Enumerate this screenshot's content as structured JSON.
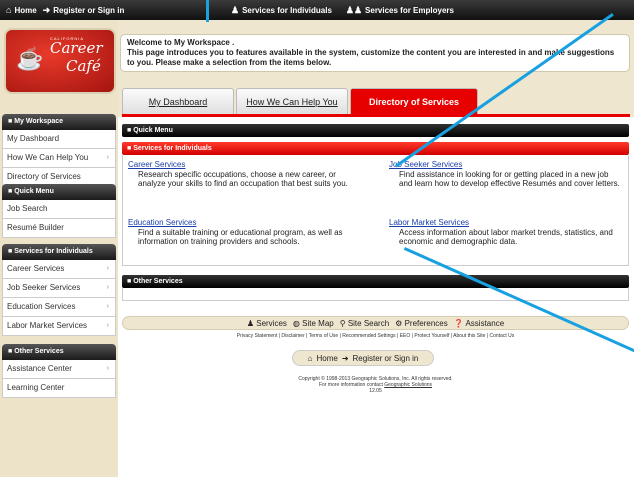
{
  "topbar": {
    "home": "Home",
    "register": "Register or Sign in",
    "individuals": "Services for Individuals",
    "employers": "Services for Employers"
  },
  "logo": {
    "small": "CALIFORNIA",
    "line1": "Career",
    "line2": "Café"
  },
  "welcome": {
    "title": "Welcome to My Workspace .",
    "text": "This page introduces you to features available in the system, customize the content you are interested in and make suggestions to you. Please make a selection from the items below."
  },
  "sidebar": {
    "my_workspace": {
      "header": "My Workspace",
      "items": [
        "My Dashboard",
        "How We Can Help You",
        "Directory of Services"
      ]
    },
    "quick_menu": {
      "header": "Quick Menu",
      "items": [
        "Job Search",
        "Resumé Builder"
      ]
    },
    "services_individuals": {
      "header": "Services for Individuals",
      "items": [
        "Career Services",
        "Job Seeker Services",
        "Education Services",
        "Labor Market Services"
      ]
    },
    "other_services": {
      "header": "Other Services",
      "items": [
        "Assistance Center",
        "Learning Center"
      ]
    }
  },
  "tabs": [
    "My Dashboard",
    "How We Can Help You",
    "Directory of Services"
  ],
  "sections": {
    "quick_menu": "Quick Menu",
    "services_individuals": "Services for Individuals",
    "other_services": "Other Services"
  },
  "services": [
    {
      "title": "Career Services",
      "desc": "Research specific occupations, choose a new career, or analyze your skills to find an occupation that best suits you."
    },
    {
      "title": "Job Seeker Services",
      "desc": "Find assistance in looking for or getting placed in a new job and learn how to develop effective Resumés and cover letters."
    },
    {
      "title": "Education Services",
      "desc": "Find a suitable training or educational program, as well as information on training providers and schools."
    },
    {
      "title": "Labor Market Services",
      "desc": "Access information about labor market trends, statistics, and economic and demographic data."
    }
  ],
  "footer": {
    "services": "Services",
    "site_map": "Site Map",
    "site_search": "Site Search",
    "preferences": "Preferences",
    "assistance": "Assistance",
    "links": "Privacy Statement | Disclaimer | Terms of Use | Recommended Settings | EEO | Protect Yourself | About this Site | Contact Us",
    "home": "Home",
    "register": "Register or Sign in",
    "copyright": "Copyright © 1998-2013 Geographic Solutions, Inc. All rights reserved.",
    "contact_prefix": "For more information contact",
    "contact_link": "Geographic Solutions",
    "version": "12.05"
  },
  "colors": {
    "accent": "#e60000",
    "link": "#1a3ea8",
    "annotation": "#18a0e0"
  }
}
